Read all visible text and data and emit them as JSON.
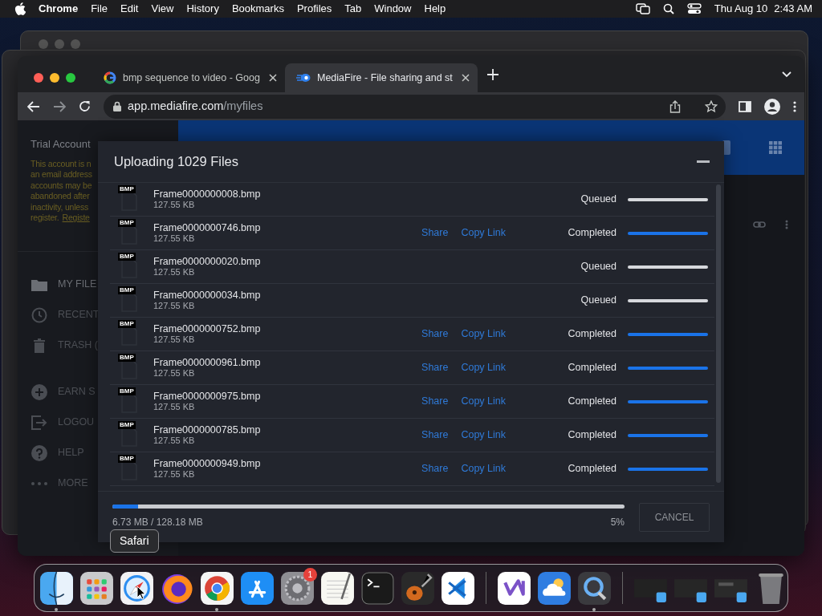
{
  "menu_bar": {
    "app": "Chrome",
    "menus": [
      "File",
      "Edit",
      "View",
      "History",
      "Bookmarks",
      "Profiles",
      "Tab",
      "Window",
      "Help"
    ],
    "date": "Thu Aug 10",
    "time": "2:43 AM"
  },
  "browser": {
    "tabs": [
      {
        "title": "bmp sequence to video - Goog",
        "selected": false
      },
      {
        "title": "MediaFire - File sharing and st",
        "selected": true
      }
    ],
    "address": {
      "host": "app.mediafire.com",
      "path": "/myfiles"
    }
  },
  "sidebar": {
    "title": "Trial Account",
    "notice_lines": [
      "This account is n",
      "an email address",
      "accounts may be",
      "abandoned after",
      "inactivity, unless",
      "register."
    ],
    "notice_link": "Registe",
    "items": [
      {
        "label": "MY FILE",
        "selected": true
      },
      {
        "label": "RECENT",
        "selected": false
      },
      {
        "label": "TRASH (",
        "selected": false
      },
      {
        "label": "EARN S",
        "selected": false
      },
      {
        "label": "LOGOU",
        "selected": false
      },
      {
        "label": "HELP",
        "selected": false
      },
      {
        "label": "MORE",
        "selected": false
      }
    ]
  },
  "upload_dialog": {
    "title": "Uploading 1029 Files",
    "files": [
      {
        "type_label": "BMP",
        "name": "Frame0000000008.bmp",
        "size": "127.55 KB",
        "status": "Queued"
      },
      {
        "type_label": "BMP",
        "name": "Frame0000000746.bmp",
        "size": "127.55 KB",
        "actions": [
          "Share",
          "Copy Link"
        ],
        "status": "Completed",
        "level": 1
      },
      {
        "type_label": "BMP",
        "name": "Frame0000000020.bmp",
        "size": "127.55 KB",
        "status": "Queued"
      },
      {
        "type_label": "BMP",
        "name": "Frame0000000034.bmp",
        "size": "127.55 KB",
        "status": "Queued"
      },
      {
        "type_label": "BMP",
        "name": "Frame0000000752.bmp",
        "size": "127.55 KB",
        "actions": [
          "Share",
          "Copy Link"
        ],
        "status": "Completed",
        "level": 1
      },
      {
        "type_label": "BMP",
        "name": "Frame0000000961.bmp",
        "size": "127.55 KB",
        "actions": [
          "Share",
          "Copy Link"
        ],
        "status": "Completed",
        "level": 1
      },
      {
        "type_label": "BMP",
        "name": "Frame0000000975.bmp",
        "size": "127.55 KB",
        "actions": [
          "Share",
          "Copy Link"
        ],
        "status": "Completed",
        "level": 1
      },
      {
        "type_label": "BMP",
        "name": "Frame0000000785.bmp",
        "size": "127.55 KB",
        "actions": [
          "Share",
          "Copy Link"
        ],
        "status": "Completed",
        "level": 1
      },
      {
        "type_label": "BMP",
        "name": "Frame0000000949.bmp",
        "size": "127.55 KB",
        "actions": [
          "Share",
          "Copy Link"
        ],
        "status": "Completed",
        "level": 1
      }
    ],
    "total": "6.73 MB / 128.18 MB",
    "percent": "5%",
    "level": 0.05,
    "cancel": "CANCEL"
  },
  "tooltip": "Safari",
  "dock": {
    "sections": [
      {
        "apps": [
          {
            "running": true
          },
          {
            "running": false
          },
          {
            "running": false
          },
          {
            "running": false
          },
          {
            "running": true
          },
          {
            "running": false
          },
          {
            "running": false,
            "badge": "1"
          },
          {
            "running": false
          },
          {
            "running": false
          },
          {
            "running": false
          },
          {
            "running": false
          }
        ]
      },
      {
        "apps": [
          {
            "running": false
          },
          {
            "running": false
          },
          {
            "running": true
          }
        ]
      },
      {
        "apps": [
          {
            "running": false
          },
          {
            "running": false
          },
          {
            "running": false
          },
          {
            "running": false
          }
        ]
      }
    ]
  }
}
